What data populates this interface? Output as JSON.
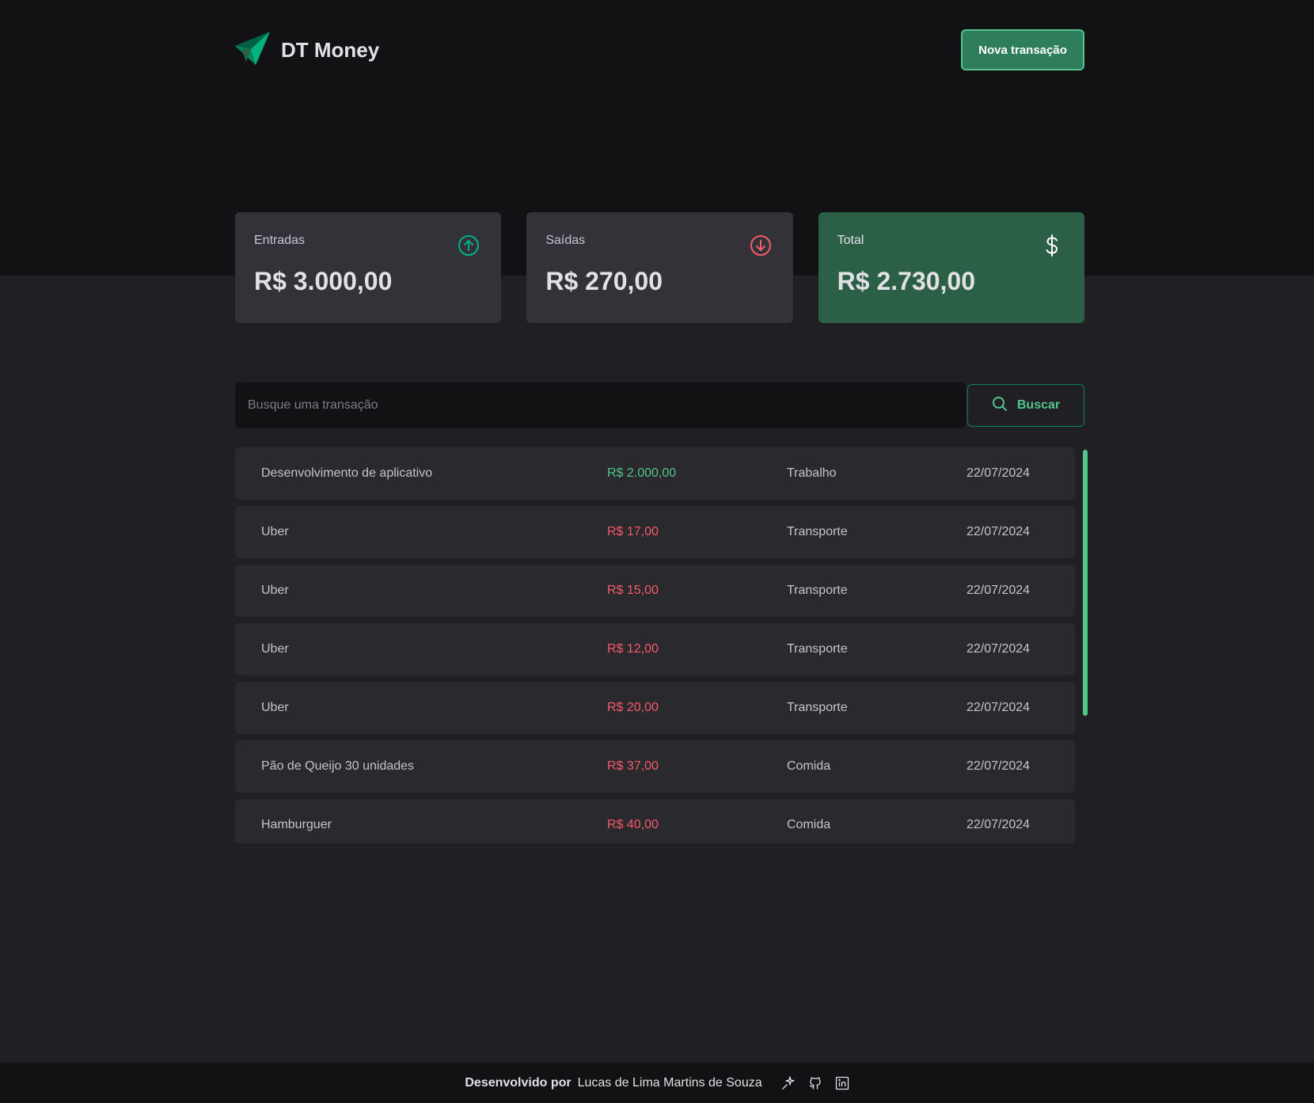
{
  "header": {
    "brand": "DT Money",
    "logo_icon": "paper-plane-logo",
    "new_transaction_label": "Nova transação"
  },
  "summary": {
    "income": {
      "label": "Entradas",
      "value": "R$ 3.000,00",
      "icon": "arrow-circle-up-icon",
      "color": "#00b37e"
    },
    "outcome": {
      "label": "Saídas",
      "value": "R$ 270,00",
      "icon": "arrow-circle-down-icon",
      "color": "#f75a68"
    },
    "total": {
      "label": "Total",
      "value": "R$ 2.730,00",
      "icon": "currency-dollar-icon",
      "color": "#2b6047"
    }
  },
  "search": {
    "placeholder": "Busque uma transação",
    "button_label": "Buscar",
    "icon": "search-icon"
  },
  "transactions": [
    {
      "description": "Desenvolvimento de aplicativo",
      "amount": "R$ 2.000,00",
      "type": "income",
      "category": "Trabalho",
      "date": "22/07/2024"
    },
    {
      "description": "Uber",
      "amount": "R$ 17,00",
      "type": "outcome",
      "category": "Transporte",
      "date": "22/07/2024"
    },
    {
      "description": "Uber",
      "amount": "R$ 15,00",
      "type": "outcome",
      "category": "Transporte",
      "date": "22/07/2024"
    },
    {
      "description": "Uber",
      "amount": "R$ 12,00",
      "type": "outcome",
      "category": "Transporte",
      "date": "22/07/2024"
    },
    {
      "description": "Uber",
      "amount": "R$ 20,00",
      "type": "outcome",
      "category": "Transporte",
      "date": "22/07/2024"
    },
    {
      "description": "Pão de Queijo 30 unidades",
      "amount": "R$ 37,00",
      "type": "outcome",
      "category": "Comida",
      "date": "22/07/2024"
    },
    {
      "description": "Hamburguer",
      "amount": "R$ 40,00",
      "type": "outcome",
      "category": "Comida",
      "date": "22/07/2024"
    }
  ],
  "footer": {
    "prefix": "Desenvolvido por",
    "author": "Lucas de Lima Martins de Souza",
    "icons": [
      "sparkle-icon",
      "github-icon",
      "linkedin-icon"
    ]
  },
  "colors": {
    "accent": "#00875f",
    "accent_light": "#52c48c",
    "income": "#00b37e",
    "outcome": "#f75a68",
    "background": "#202024",
    "header_background": "#121214",
    "card": "#323238",
    "row": "#29292e"
  }
}
